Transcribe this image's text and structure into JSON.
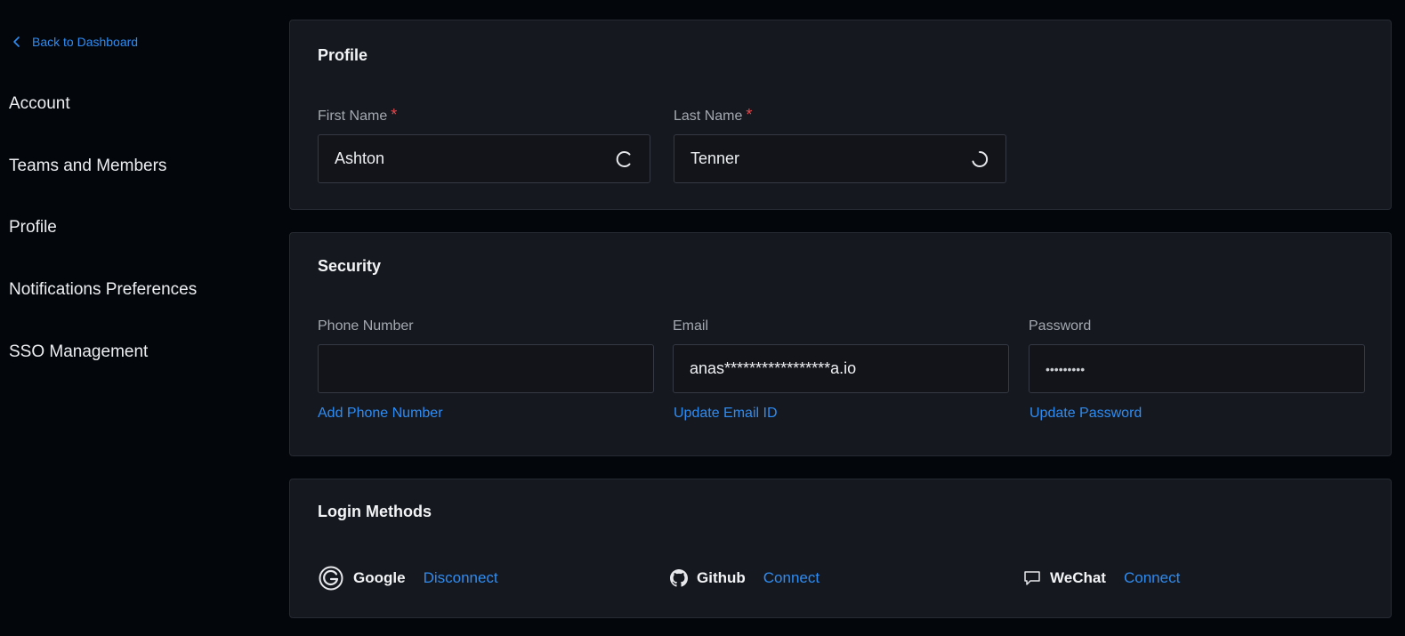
{
  "sidebar": {
    "back_label": "Back to Dashboard",
    "items": [
      {
        "label": "Account"
      },
      {
        "label": "Teams and Members"
      },
      {
        "label": "Profile"
      },
      {
        "label": "Notifications Preferences"
      },
      {
        "label": "SSO Management"
      }
    ]
  },
  "profile": {
    "title": "Profile",
    "first_name_label": "First Name",
    "first_name_value": "Ashton",
    "last_name_label": "Last Name",
    "last_name_value": "Tenner",
    "required_mark": "*"
  },
  "security": {
    "title": "Security",
    "phone_label": "Phone Number",
    "phone_value": "",
    "phone_action": "Add Phone Number",
    "email_label": "Email",
    "email_value": "anas*****************a.io",
    "email_action": "Update Email ID",
    "password_label": "Password",
    "password_value": "•••••••••",
    "password_action": "Update Password"
  },
  "login_methods": {
    "title": "Login Methods",
    "items": [
      {
        "name": "Google",
        "action": "Disconnect",
        "icon": "google-icon"
      },
      {
        "name": "Github",
        "action": "Connect",
        "icon": "github-icon"
      },
      {
        "name": "WeChat",
        "action": "Connect",
        "icon": "chat-bubble-icon"
      }
    ]
  },
  "colors": {
    "background": "#03060b",
    "card": "#15181e",
    "accent": "#2f8cf2",
    "required": "#e5484d"
  }
}
